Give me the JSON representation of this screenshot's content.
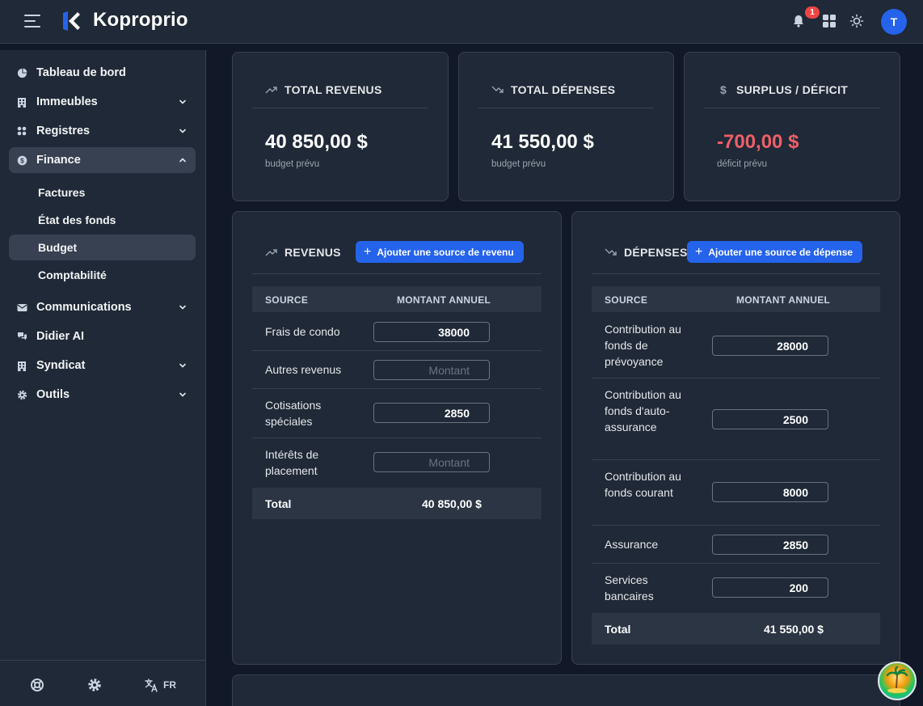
{
  "app": {
    "brand": "Koproprio",
    "notification_count": "1",
    "avatar_initial": "T"
  },
  "sidebar": {
    "items": [
      {
        "label": "Tableau de bord",
        "icon": "pie-chart-icon"
      },
      {
        "label": "Immeubles",
        "icon": "building-icon"
      },
      {
        "label": "Registres",
        "icon": "grid-icon"
      },
      {
        "label": "Finance",
        "icon": "dollar-circle-icon"
      },
      {
        "label": "Communications",
        "icon": "mail-icon"
      },
      {
        "label": "Didier AI",
        "icon": "chat-icon"
      },
      {
        "label": "Syndicat",
        "icon": "building-icon"
      },
      {
        "label": "Outils",
        "icon": "gear-icon"
      }
    ],
    "finance_sub": [
      "Factures",
      "État des fonds",
      "Budget",
      "Comptabilité"
    ],
    "language": "FR"
  },
  "stats": {
    "revenus": {
      "title": "TOTAL REVENUS",
      "value": "40 850,00 $",
      "sub": "budget prévu"
    },
    "depenses": {
      "title": "TOTAL DÉPENSES",
      "value": "41 550,00 $",
      "sub": "budget prévu"
    },
    "surplus": {
      "title": "SURPLUS / DÉFICIT",
      "value": "-700,00 $",
      "sub": "déficit prévu"
    }
  },
  "revenus_panel": {
    "title": "REVENUS",
    "add_button": "Ajouter une source de revenu",
    "col_source": "SOURCE",
    "col_amount": "MONTANT ANNUEL",
    "placeholder": "Montant",
    "rows": [
      {
        "source": "Frais de condo",
        "amount": "38000"
      },
      {
        "source": "Autres revenus",
        "amount": ""
      },
      {
        "source": "Cotisations spéciales",
        "amount": "2850"
      },
      {
        "source": "Intérêts de placement",
        "amount": ""
      }
    ],
    "total_label": "Total",
    "total_value": "40 850,00 $"
  },
  "depenses_panel": {
    "title": "DÉPENSES",
    "add_button": "Ajouter une source de dépense",
    "col_source": "SOURCE",
    "col_amount": "MONTANT ANNUEL",
    "placeholder": "Montant",
    "rows": [
      {
        "source": "Contribution au fonds de prévoyance",
        "amount": "28000"
      },
      {
        "source": "Contribution au fonds d'auto-assurance",
        "amount": "2500"
      },
      {
        "source": "Contribution au fonds courant",
        "amount": "8000"
      },
      {
        "source": "Assurance",
        "amount": "2850"
      },
      {
        "source": "Services bancaires",
        "amount": "200"
      }
    ],
    "total_label": "Total",
    "total_value": "41 550,00 $"
  },
  "colors": {
    "accent": "#2563eb",
    "deficit": "#ef5f67",
    "badge": "#ef4444"
  }
}
